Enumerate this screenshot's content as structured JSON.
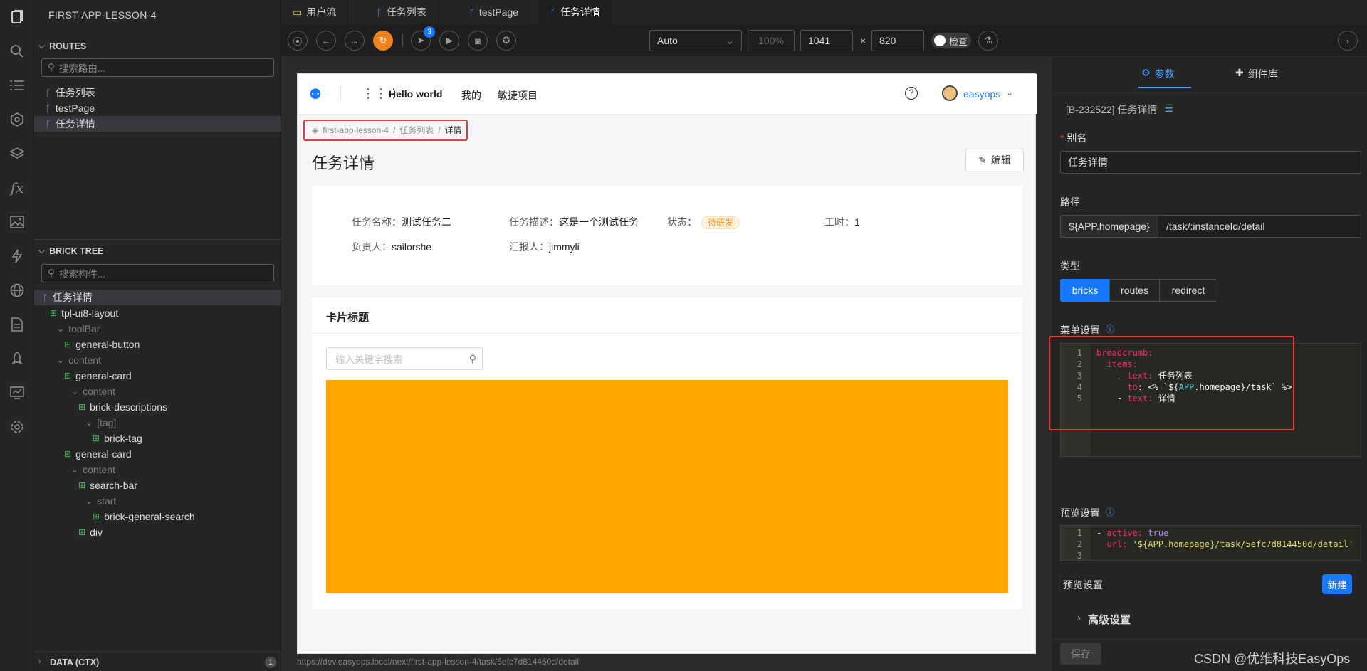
{
  "app": {
    "title": "FIRST-APP-LESSON-4"
  },
  "activity_icons": [
    "pages-icon",
    "search-icon",
    "list-icon",
    "plugin-icon",
    "layers-icon",
    "function-icon",
    "image-icon",
    "lightning-icon",
    "globe-icon",
    "document-icon",
    "rocket-icon",
    "monitor-icon",
    "settings-icon"
  ],
  "routes": {
    "header": "ROUTES",
    "search_placeholder": "搜索路由...",
    "items": [
      "任务列表",
      "testPage",
      "任务详情"
    ]
  },
  "brick_tree": {
    "header": "BRICK TREE",
    "search_placeholder": "搜索构件...",
    "root": "任务详情",
    "nodes": [
      "tpl-ui8-layout",
      "toolBar",
      "general-button",
      "content",
      "general-card",
      "content",
      "brick-descriptions",
      "[tag]",
      "brick-tag",
      "general-card",
      "content",
      "search-bar",
      "start",
      "brick-general-search",
      "div"
    ]
  },
  "data_footer": {
    "label": "DATA (CTX)",
    "count": "1"
  },
  "tabs": [
    "用户流",
    "任务列表",
    "testPage",
    "任务详情"
  ],
  "toolbar": {
    "badge": "3",
    "device": "Auto",
    "zoom": "100%",
    "width": "1041",
    "times": "×",
    "height": "820",
    "inspect_label": "检查"
  },
  "preview": {
    "nav": {
      "title": "Hello world",
      "links": [
        "我的",
        "敏捷项目"
      ],
      "user": "easyops"
    },
    "breadcrumb": [
      "first-app-lesson-4",
      "任务列表",
      "详情"
    ],
    "breadcrumb_sep": "/",
    "page_title": "任务详情",
    "edit_label": "编辑",
    "desc": [
      {
        "label": "任务名称：",
        "value": "测试任务二"
      },
      {
        "label": "任务描述：",
        "value": "这是一个测试任务"
      },
      {
        "label": "状态：",
        "value": "待研发"
      },
      {
        "label": "工时：",
        "value": "1"
      },
      {
        "label": "负责人：",
        "value": "sailorshe"
      },
      {
        "label": "汇报人：",
        "value": "jimmyli"
      }
    ],
    "card_title": "卡片标题",
    "search_placeholder": "输入关键字搜索",
    "block_color": "#ffa500",
    "status_url": "https://dev.easyops.local/next/first-app-lesson-4/task/5efc7d814450d/detail"
  },
  "right_panel": {
    "tabs": [
      "参数",
      "组件库"
    ],
    "brick_id": "[B-232522] 任务详情",
    "alias_label": "别名",
    "alias_required": "*",
    "alias_value": "任务详情",
    "path_label": "路径",
    "path_prefix": "${APP.homepage}",
    "path_value": "/task/:instanceId/detail",
    "type_label": "类型",
    "type_options": [
      "bricks",
      "routes",
      "redirect"
    ],
    "menu_label": "菜单设置",
    "menu_code": {
      "line_numbers": [
        "1",
        "2",
        "3",
        "4",
        "5"
      ],
      "lines": [
        [
          {
            "t": "breadcrumb:",
            "c": "#f92672"
          }
        ],
        [
          {
            "t": "  items:",
            "c": "#f92672"
          }
        ],
        [
          {
            "t": "    - ",
            "c": "#f8f8f2"
          },
          {
            "t": "text:",
            "c": "#f92672"
          },
          {
            "t": " 任务列表",
            "c": "#f8f8f2"
          }
        ],
        [
          {
            "t": "      to",
            "c": "#f92672"
          },
          {
            "t": ": <% `${",
            "c": "#f8f8f2"
          },
          {
            "t": "APP",
            "c": "#66d9ef"
          },
          {
            "t": ".homepage}/task` %>",
            "c": "#f8f8f2"
          }
        ],
        [
          {
            "t": "    - ",
            "c": "#f8f8f2"
          },
          {
            "t": "text:",
            "c": "#f92672"
          },
          {
            "t": " 详情",
            "c": "#f8f8f2"
          }
        ]
      ]
    },
    "preview_label": "预览设置",
    "preview_code": {
      "line_numbers": [
        "1",
        "2",
        "3"
      ],
      "lines": [
        [
          {
            "t": "- ",
            "c": "#f8f8f2"
          },
          {
            "t": "active:",
            "c": "#f92672"
          },
          {
            "t": " true",
            "c": "#ae81ff"
          }
        ],
        [
          {
            "t": "  url:",
            "c": "#f92672"
          },
          {
            "t": " '${APP.homepage}/task/5efc7d814450d/detail'",
            "c": "#e6db74"
          }
        ],
        [
          {
            "t": "",
            "c": "#f8f8f2"
          }
        ]
      ]
    },
    "preview_label2": "预览设置",
    "new_label": "新建",
    "advanced_label": "高级设置",
    "save_label": "保存",
    "watermark": "CSDN @优维科技EasyOps"
  }
}
